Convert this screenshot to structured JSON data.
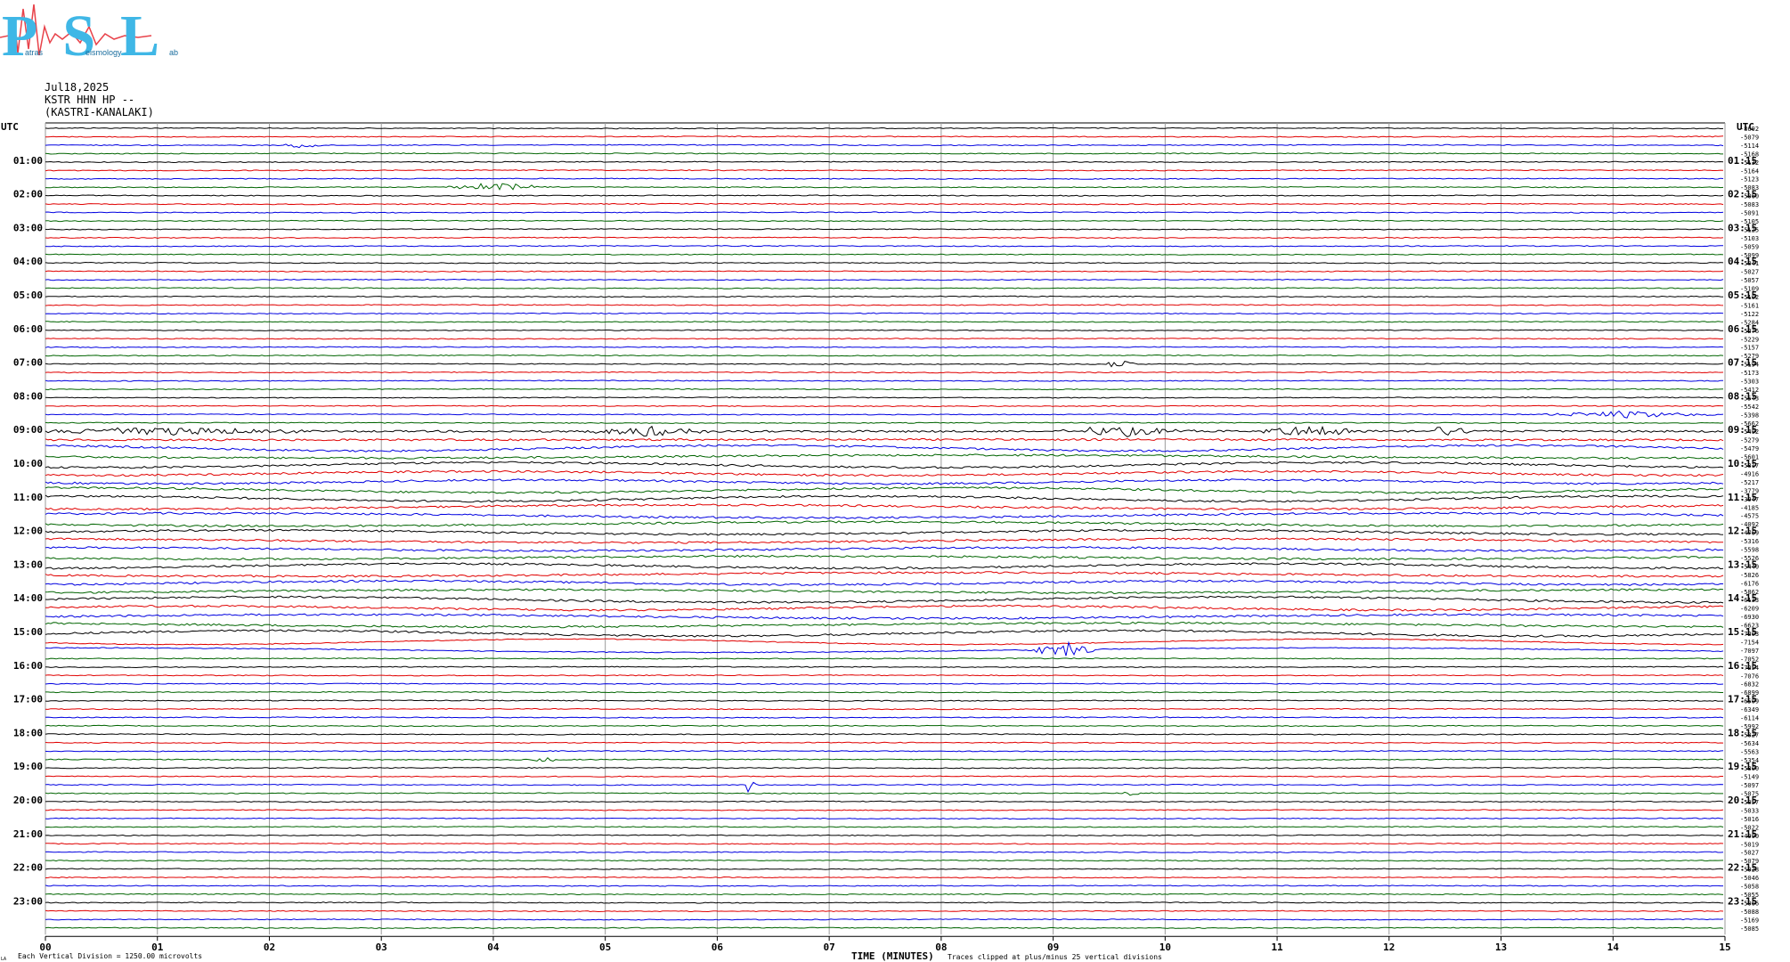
{
  "header": {
    "date": "Jul18,2025",
    "station": "KSTR HHN HP --",
    "location": "(KASTRI-KANALAKI)"
  },
  "logo": {
    "text": "PSL",
    "small_words": [
      "atras",
      "eismology",
      "ab"
    ],
    "color": "#3fb7e6",
    "wave_color": "#e8424a"
  },
  "chart_data": {
    "type": "line",
    "title": "",
    "utc_label": "UTC",
    "xlabel": "TIME (MINUTES)",
    "x_ticks": [
      "00",
      "01",
      "02",
      "03",
      "04",
      "05",
      "06",
      "07",
      "08",
      "09",
      "10",
      "11",
      "12",
      "13",
      "14",
      "15"
    ],
    "xlim": [
      0,
      15
    ],
    "left_time_labels": [
      "01:00",
      "02:00",
      "03:00",
      "04:00",
      "05:00",
      "06:00",
      "07:00",
      "08:00",
      "09:00",
      "10:00",
      "11:00",
      "12:00",
      "13:00",
      "14:00",
      "15:00",
      "16:00",
      "17:00",
      "18:00",
      "19:00",
      "20:00",
      "21:00",
      "22:00",
      "23:00"
    ],
    "right_time_labels": [
      "01:15",
      "02:15",
      "03:15",
      "04:15",
      "05:15",
      "06:15",
      "07:15",
      "08:15",
      "09:15",
      "10:15",
      "11:15",
      "12:15",
      "13:15",
      "14:15",
      "15:15",
      "16:15",
      "17:15",
      "18:15",
      "19:15",
      "20:15",
      "21:15",
      "22:15",
      "23:15"
    ],
    "trace_colors": [
      "#000000",
      "#e00000",
      "#0000e0",
      "#006400"
    ],
    "trace_count": 96,
    "trace_minutes": 15,
    "right_values": [
      "-8692",
      "-5079",
      "-5114",
      "-5168",
      "-5132",
      "-5164",
      "-5123",
      "-5083",
      "-5060",
      "-5083",
      "-5091",
      "-5105",
      "-5125",
      "-5103",
      "-5059",
      "-5099",
      "-5041",
      "-5027",
      "-5057",
      "-5109",
      "-5102",
      "-5161",
      "-5122",
      "-5284",
      "-5276",
      "-5229",
      "-5157",
      "-5279",
      "-5194",
      "-5173",
      "-5303",
      "-5412",
      "-5543",
      "-5542",
      "-5398",
      "-5662",
      "-5492",
      "-5279",
      "-5479",
      "-5601",
      "-5317",
      "-4916",
      "-5217",
      "-3779",
      "-3947",
      "-4185",
      "-4575",
      "-4092",
      "-4769",
      "-5316",
      "-5598",
      "-5526",
      "-5440",
      "-5826",
      "-6176",
      "-5862",
      "-6133",
      "-6209",
      "-6930",
      "-6623",
      "-7203",
      "-7154",
      "-7097",
      "-7052",
      "-7254",
      "-7076",
      "-6832",
      "-6899",
      "-6509",
      "-6349",
      "-6114",
      "-5992",
      "-5827",
      "-5634",
      "-5563",
      "-5354",
      "-5300",
      "-5149",
      "-5097",
      "-5075",
      "-5057",
      "-5033",
      "-5016",
      "-5022",
      "-4990",
      "-5019",
      "-5027",
      "-5079",
      "-5028",
      "-5046",
      "-5058",
      "-5055",
      "-5066",
      "-5088",
      "-5169",
      "-5085"
    ],
    "events": [
      {
        "trace": 2,
        "minute": 2.3,
        "amp": 4,
        "width": 0.2
      },
      {
        "trace": 7,
        "minute": 4.0,
        "amp": 5,
        "width": 0.5
      },
      {
        "trace": 28,
        "minute": 9.6,
        "amp": 8,
        "width": 0.15
      },
      {
        "trace": 34,
        "minute": 14.1,
        "amp": 4,
        "width": 0.9
      },
      {
        "trace": 36,
        "minute": 1.0,
        "amp": 5,
        "width": 1.6
      },
      {
        "trace": 36,
        "minute": 5.4,
        "amp": 6,
        "width": 0.6
      },
      {
        "trace": 36,
        "minute": 9.6,
        "amp": 6,
        "width": 0.7
      },
      {
        "trace": 36,
        "minute": 11.3,
        "amp": 6,
        "width": 0.6
      },
      {
        "trace": 36,
        "minute": 12.5,
        "amp": 6,
        "width": 0.3
      },
      {
        "trace": 62,
        "minute": 9.1,
        "amp": 9,
        "width": 0.35
      },
      {
        "trace": 75,
        "minute": 4.45,
        "amp": 3,
        "width": 0.15
      },
      {
        "trace": 78,
        "minute": 6.3,
        "amp": 16,
        "width": 0.05
      },
      {
        "trace": 79,
        "minute": 9.7,
        "amp": 3,
        "width": 0.1
      }
    ],
    "footer_left": "Each Vertical Division = 1250.00 microvolts",
    "footer_right": "Traces clipped at plus/minus 25 vertical divisions",
    "corner_mark": "LA"
  }
}
